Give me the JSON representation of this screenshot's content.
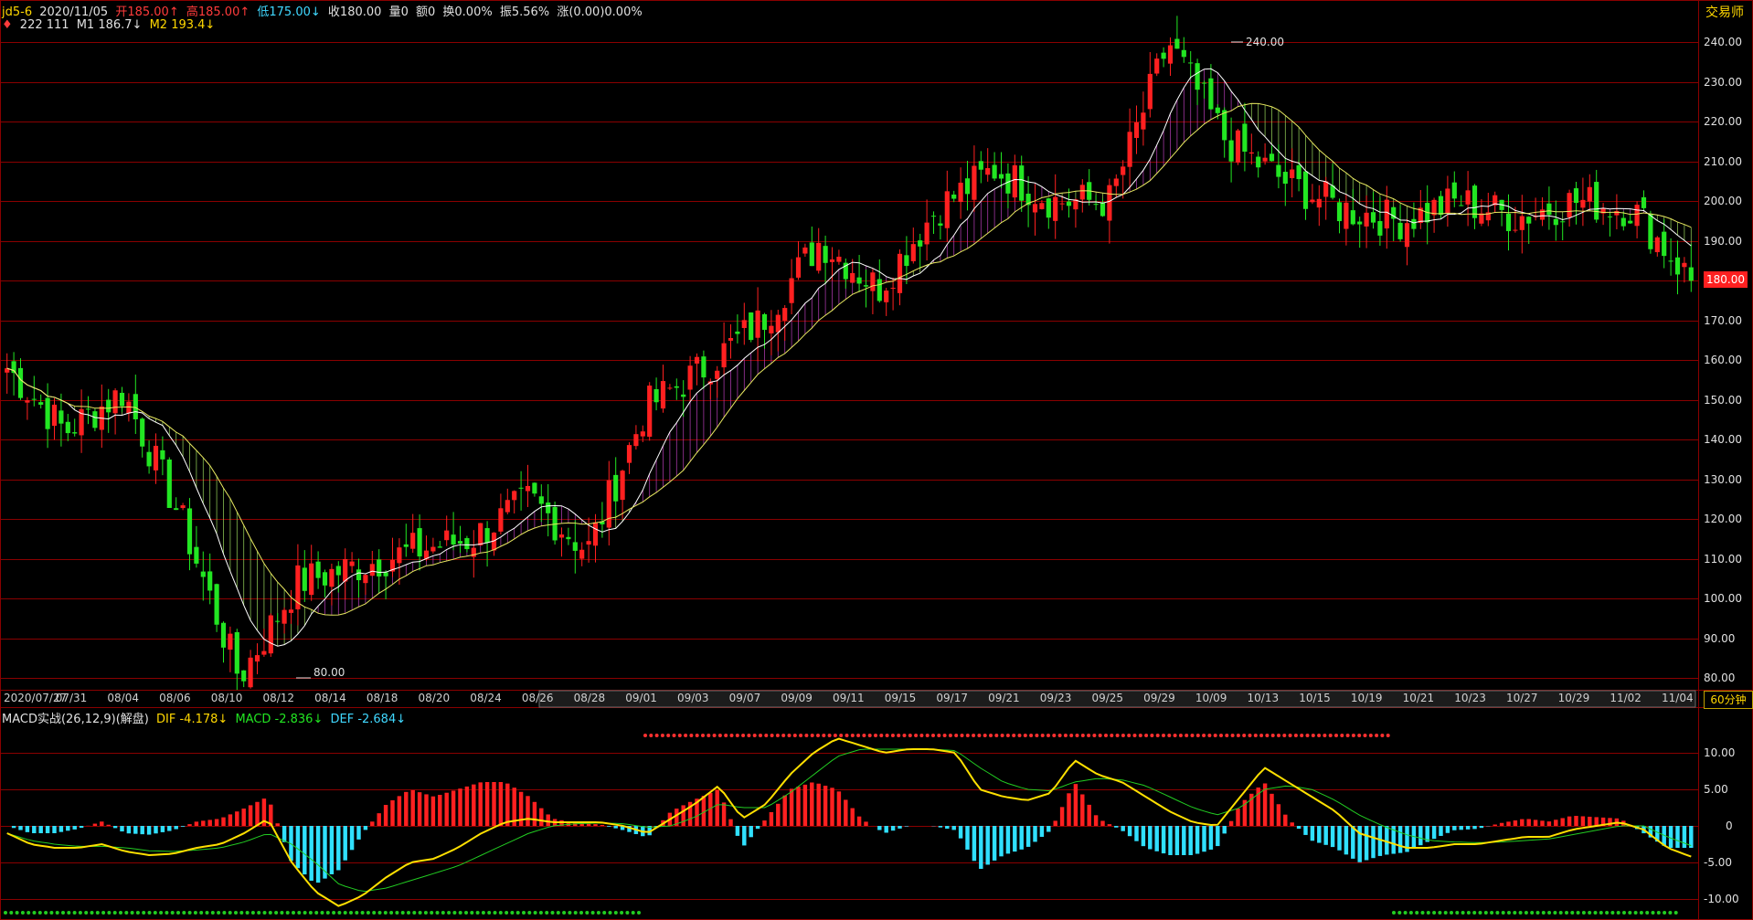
{
  "header": {
    "symbol": "jd5-6",
    "date": "2020/11/05",
    "open": "开185.00↑",
    "high": "高185.00↑",
    "low": "低175.00↓",
    "close": "收180.00",
    "volume": "量0",
    "amount": "额0",
    "turnover": "换0.00%",
    "amplitude": "振5.56%",
    "change": "涨(0.00)0.00%",
    "ma_params": "222  111",
    "m1": "M1 186.7↓",
    "m2": "M2 193.4↓",
    "brand": "交易师"
  },
  "macd_header": {
    "title": "MACD实战(26,12,9)(解盘)",
    "dif": "DIF -4.178↓",
    "macd": "MACD -2.836↓",
    "def": "DEF -2.684↓"
  },
  "period_button": "60分钟",
  "current_price_tag": "180.00",
  "annotations": {
    "high": "240.00",
    "low": "80.00"
  },
  "colors": {
    "up": "#ff2020",
    "down": "#22e622",
    "grid": "#8a0000",
    "m1": "#ffffff",
    "m2": "#e8e860",
    "dif": "#ffe000",
    "dea": "#22cc22",
    "macd_pos": "#ff2020",
    "macd_neg": "#30e0ff",
    "fill_bull": "#c040c0",
    "fill_bear": "#a0e060"
  },
  "chart_data": [
    {
      "type": "candlestick",
      "title": "jd5-6",
      "x_labels": [
        "2020/07/27",
        "07/31",
        "08/04",
        "08/06",
        "08/10",
        "08/12",
        "08/14",
        "08/18",
        "08/20",
        "08/24",
        "08/26",
        "08/28",
        "09/01",
        "09/03",
        "09/07",
        "09/09",
        "09/11",
        "09/15",
        "09/17",
        "09/21",
        "09/23",
        "09/25",
        "09/29",
        "10/09",
        "10/13",
        "10/15",
        "10/19",
        "10/21",
        "10/23",
        "10/27",
        "10/29",
        "11/02",
        "11/04"
      ],
      "y_ticks": [
        "240.00",
        "230.00",
        "220.00",
        "210.00",
        "200.00",
        "190.00",
        "180.00",
        "170.00",
        "160.00",
        "150.00",
        "140.00",
        "130.00",
        "120.00",
        "110.00",
        "100.00",
        "90.00",
        "80.00"
      ],
      "ylim": [
        80,
        240
      ],
      "key_points": [
        {
          "label": "2020/07/27",
          "price": 158
        },
        {
          "label": "08/04",
          "price": 142
        },
        {
          "label": "08/06",
          "price": 152
        },
        {
          "label": "08/10",
          "price": 120
        },
        {
          "label": "08/12",
          "price": 80
        },
        {
          "label": "08/14",
          "price": 104
        },
        {
          "label": "08/18",
          "price": 108
        },
        {
          "label": "08/24",
          "price": 112
        },
        {
          "label": "08/28",
          "price": 115
        },
        {
          "label": "09/01",
          "price": 125
        },
        {
          "label": "09/03",
          "price": 112
        },
        {
          "label": "09/07",
          "price": 148
        },
        {
          "label": "09/09",
          "price": 158
        },
        {
          "label": "09/11",
          "price": 170
        },
        {
          "label": "09/15",
          "price": 190
        },
        {
          "label": "09/17",
          "price": 178
        },
        {
          "label": "09/21",
          "price": 198
        },
        {
          "label": "09/23",
          "price": 208
        },
        {
          "label": "09/25",
          "price": 200
        },
        {
          "label": "09/29",
          "price": 200
        },
        {
          "label": "10/09",
          "price": 240
        },
        {
          "label": "10/13",
          "price": 215
        },
        {
          "label": "10/15",
          "price": 205
        },
        {
          "label": "10/19",
          "price": 198
        },
        {
          "label": "10/21",
          "price": 195
        },
        {
          "label": "10/23",
          "price": 200
        },
        {
          "label": "10/27",
          "price": 196
        },
        {
          "label": "10/29",
          "price": 200
        },
        {
          "label": "11/02",
          "price": 198
        },
        {
          "label": "11/04",
          "price": 180
        }
      ],
      "ma_lines": [
        "M1",
        "M2"
      ]
    },
    {
      "type": "macd",
      "title": "MACD实战(26,12,9)(解盘)",
      "y_ticks": [
        "10.00",
        "5.00",
        "0",
        "-5.00",
        "-10.00"
      ],
      "ylim": [
        -12,
        13
      ],
      "dif": [
        -1,
        -2.5,
        -3,
        -3,
        -2.5,
        -3.5,
        -4,
        -3.8,
        -3,
        -2.5,
        -1,
        1,
        -5,
        -9,
        -11,
        -9.5,
        -7,
        -5,
        -4.5,
        -3,
        -1,
        0.5,
        1,
        0.5,
        0.5,
        0.5,
        0,
        -1,
        1,
        3,
        5.5,
        1,
        3,
        7,
        10,
        12,
        11,
        10,
        10.5,
        10.5,
        10,
        5,
        4,
        3.5,
        4.5,
        9,
        7,
        6,
        4,
        2,
        0.5,
        0,
        4,
        8,
        6,
        4,
        2,
        -1,
        -2,
        -3,
        -3,
        -2.5,
        -2.5,
        -2,
        -1.5,
        -1.5,
        -0.5,
        0,
        0.5,
        -0.5,
        -3,
        -4.2
      ],
      "dea": [
        -1,
        -2,
        -2.5,
        -2.8,
        -2.8,
        -3,
        -3.4,
        -3.5,
        -3.3,
        -3,
        -2.2,
        -1,
        -2.5,
        -5,
        -8,
        -9,
        -8.5,
        -7.5,
        -6.5,
        -5.5,
        -4,
        -2.5,
        -1,
        0,
        0.3,
        0.4,
        0.3,
        -0.2,
        0,
        1.2,
        3,
        2.5,
        2.5,
        4.5,
        7,
        9.5,
        10.5,
        10.5,
        10.5,
        10.5,
        10.3,
        8,
        6,
        5,
        4.8,
        6,
        6.5,
        6.3,
        5.5,
        4,
        2.5,
        1.5,
        2.5,
        5,
        5.5,
        5,
        3.5,
        1.5,
        0,
        -1.2,
        -2,
        -2.2,
        -2.3,
        -2.2,
        -2,
        -1.8,
        -1.2,
        -0.6,
        0,
        0,
        -1.5,
        -2.7
      ],
      "hist_values": "MACD histogram = DIF - DEA (positive red, negative cyan)"
    }
  ]
}
